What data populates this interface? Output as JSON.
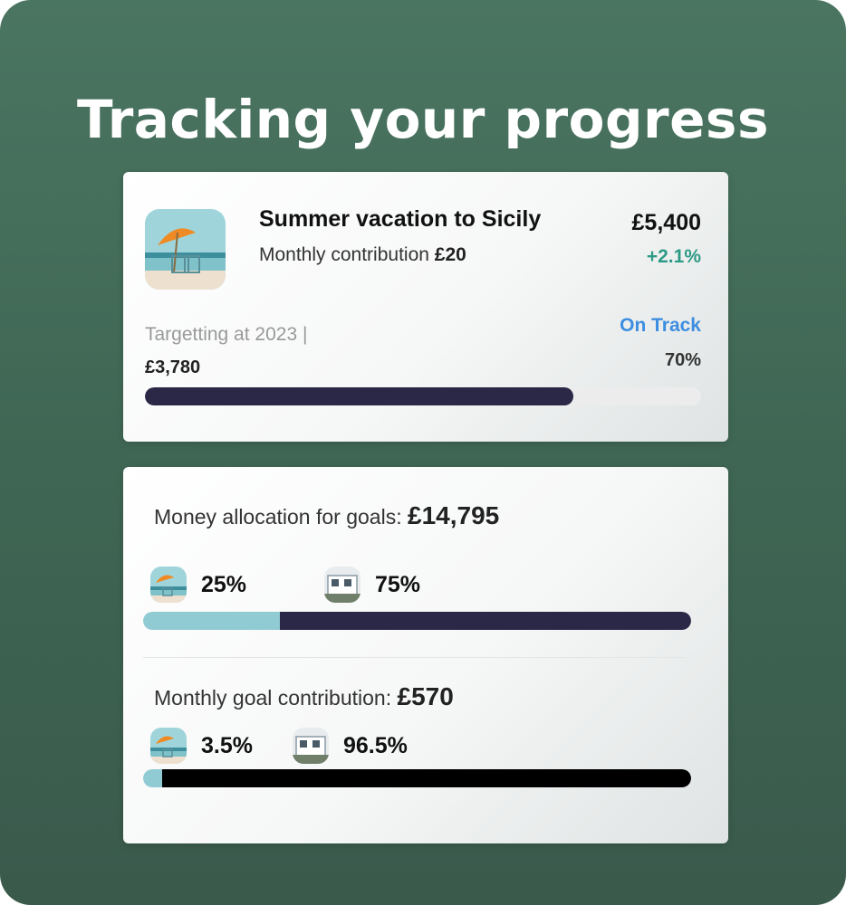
{
  "headline": "Tracking your progress",
  "goal_card": {
    "title": "Summer vacation to Sicily",
    "monthly_label": "Monthly contribution",
    "monthly_value": "£20",
    "amount": "£5,400",
    "change": "+2.1%",
    "target_label": "Targetting at 2023 |",
    "status": "On Track",
    "saved": "£3,780",
    "percent": "70%",
    "progress_fraction": 0.77,
    "colors": {
      "bar": "#2b2746",
      "positive": "#2d9a86",
      "status": "#3d8ee0"
    }
  },
  "allocation_card": {
    "money_label": "Money allocation for goals:",
    "money_total": "£14,795",
    "money_segments": [
      {
        "icon": "beach-vacation-thumbnail",
        "value": "25%",
        "fraction": 0.25,
        "color": "#90cad3"
      },
      {
        "icon": "house-thumbnail",
        "value": "75%",
        "fraction": 0.75,
        "color": "#2b2746"
      }
    ],
    "monthly_label": "Monthly goal contribution:",
    "monthly_total": "£570",
    "monthly_segments": [
      {
        "icon": "beach-vacation-thumbnail",
        "value": "3.5%",
        "fraction": 0.035,
        "color": "#90cad3"
      },
      {
        "icon": "house-thumbnail",
        "value": "96.5%",
        "fraction": 0.965,
        "color": "#000000"
      }
    ]
  }
}
